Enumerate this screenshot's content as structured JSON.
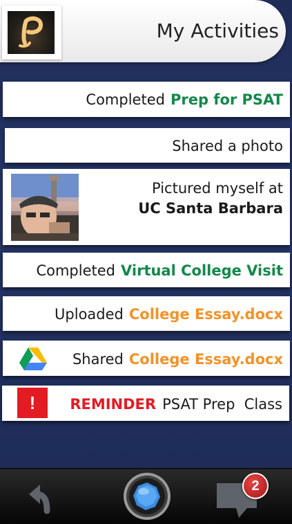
{
  "header": {
    "title": "My Activities",
    "logo_icon": "app-logo-p-icon"
  },
  "feed": [
    {
      "prefix": "Completed",
      "highlight": "Prep for PSAT",
      "color": "#12884a"
    },
    {
      "text": "Shared a photo"
    },
    {
      "line1": "Pictured myself at",
      "line2": "UC Santa Barbara",
      "image": "profile-photo"
    },
    {
      "prefix": "Completed",
      "highlight": "Virtual College Visit",
      "color": "#12884a"
    },
    {
      "prefix": "Uploaded",
      "highlight": "College Essay.docx",
      "color": "#f39228"
    },
    {
      "prefix": "Shared",
      "highlight": "College Essay.docx",
      "color": "#f39228",
      "icon": "google-drive-icon"
    },
    {
      "label": "REMINDER",
      "text": "PSAT Prep  Class",
      "color": "#e31b23",
      "icon": "alert-icon"
    }
  ],
  "bottom_bar": {
    "back_icon": "undo-arrow-icon",
    "camera_icon": "camera-lens-icon",
    "messages_icon": "speech-bubble-icon",
    "badge_count": "2"
  }
}
